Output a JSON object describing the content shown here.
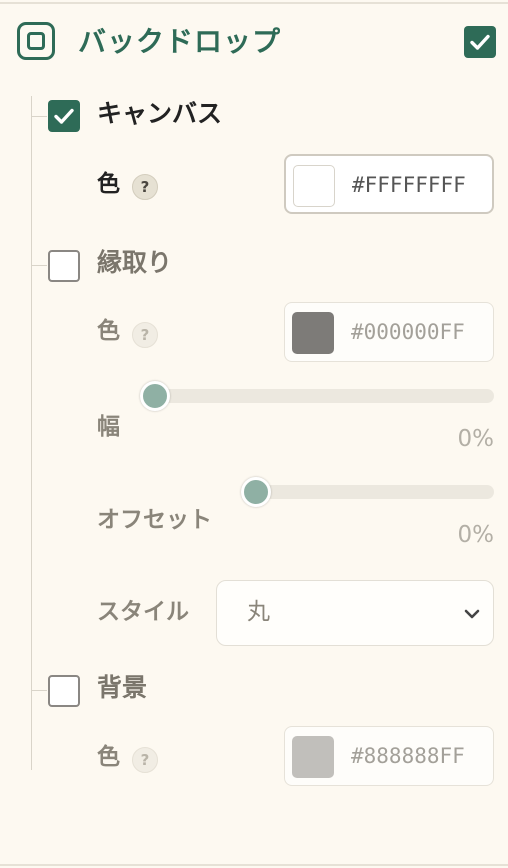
{
  "header": {
    "title": "バックドロップ",
    "enabled": true
  },
  "sections": {
    "canvas": {
      "title": "キャンバス",
      "checked": true,
      "color_label": "色",
      "help": "?",
      "color_hex": "#FFFFFFFF",
      "swatch": "#ffffff"
    },
    "border": {
      "title": "縁取り",
      "checked": false,
      "color_label": "色",
      "help": "?",
      "color_hex": "#000000FF",
      "swatch": "#7d7b78",
      "width_label": "幅",
      "width_value": "0%",
      "width_fraction": 0,
      "offset_label": "オフセット",
      "offset_value": "0%",
      "offset_fraction": 0,
      "style_label": "スタイル",
      "style_value": "丸"
    },
    "background": {
      "title": "背景",
      "checked": false,
      "color_label": "色",
      "help": "?",
      "color_hex": "#888888FF",
      "swatch": "#c1bfbb"
    }
  },
  "colors": {
    "accent": "#2e6b57",
    "background": "#fdf9f1",
    "thumb": "#8fb0a4"
  },
  "icons": {
    "header": "backdrop-square-icon",
    "check": "check-icon",
    "help": "help-icon",
    "dropdown": "chevron-down-icon"
  }
}
